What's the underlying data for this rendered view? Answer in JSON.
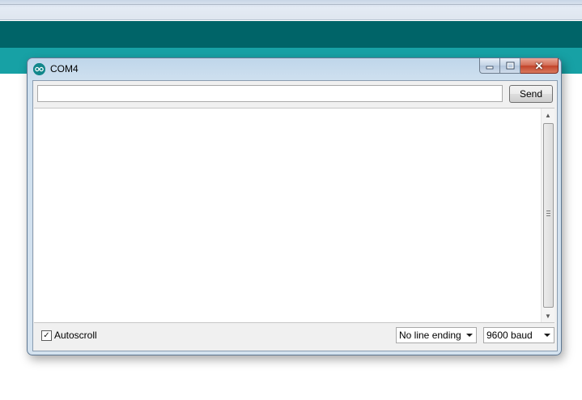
{
  "window": {
    "title": "COM4",
    "app_icon": "arduino-icon",
    "caption_buttons": [
      "minimize-icon",
      "maximize-icon",
      "close-icon"
    ]
  },
  "send_bar": {
    "input_value": "",
    "send_label": "Send"
  },
  "output": {
    "text": ""
  },
  "footer": {
    "autoscroll_label": "Autoscroll",
    "autoscroll_checked": true,
    "line_ending_selected": "No line ending",
    "baud_selected": "9600 baud"
  },
  "colors": {
    "background_teal_dark": "#006468",
    "background_teal_light": "#17a1a5",
    "close_button_red": "#c2432a"
  }
}
